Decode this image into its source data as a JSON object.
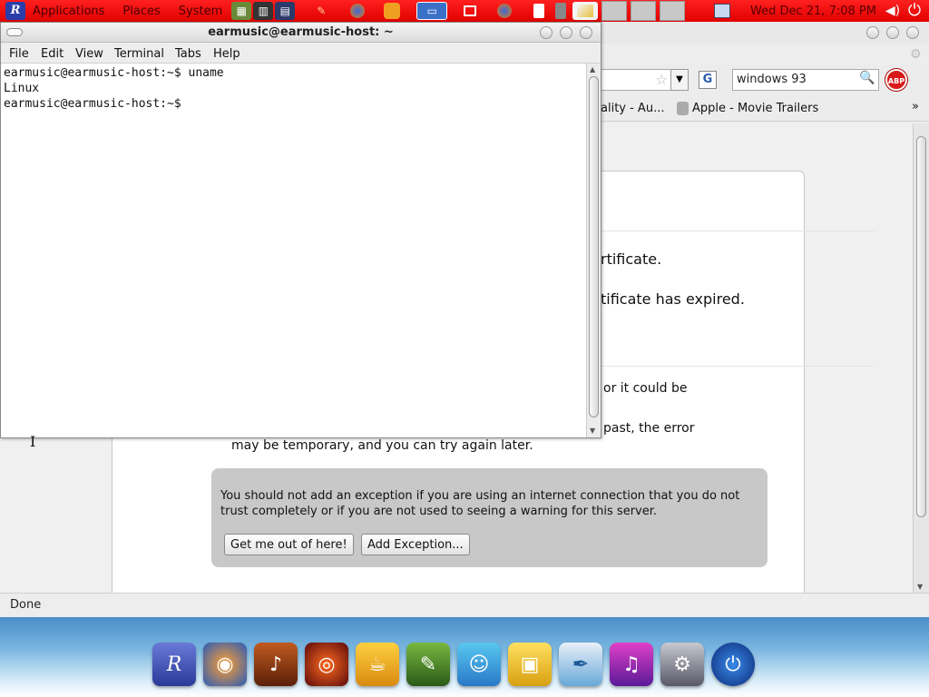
{
  "top_panel": {
    "menus": [
      "Applications",
      "Places",
      "System"
    ],
    "clock": "Wed Dec 21,  7:08 PM",
    "logo_letter": "R"
  },
  "browser": {
    "search_value": "windows 93",
    "search_engine_letter": "G",
    "abp_label": "ABP",
    "bookmarks": [
      "eality - Au...",
      "Apple - Movie Trailers"
    ],
    "bookmarks_overflow": "»",
    "error_heading_1": "rtificate.",
    "error_heading_2": "tificate has expired.",
    "error_body_1": "or it could be",
    "error_body_2": "past, the error",
    "error_body_3": "may be temporary, and you can try again later.",
    "warning_text": "You should not add an exception if you are using an internet connection that you do not trust completely or if you are not used to seeing a warning for this server.",
    "get_out_button": "Get me out of here!",
    "add_exception_button": "Add Exception...",
    "status": "Done"
  },
  "terminal": {
    "title": "earmusic@earmusic-host: ~",
    "menu": [
      "File",
      "Edit",
      "View",
      "Terminal",
      "Tabs",
      "Help"
    ],
    "lines": [
      "earmusic@earmusic-host:~$ uname",
      "Linux",
      "earmusic@earmusic-host:~$ "
    ]
  },
  "dock": {
    "icons": [
      "rosa-icon",
      "browser-icon",
      "guitar-icon",
      "media-icon",
      "coffee-icon",
      "gimp-icon",
      "messenger-icon",
      "office-icon",
      "draw-icon",
      "music-icon",
      "settings-icon",
      "power-icon"
    ]
  },
  "colors": {
    "panel_red": "#e00000",
    "warning_gray": "#c8c8c8"
  }
}
